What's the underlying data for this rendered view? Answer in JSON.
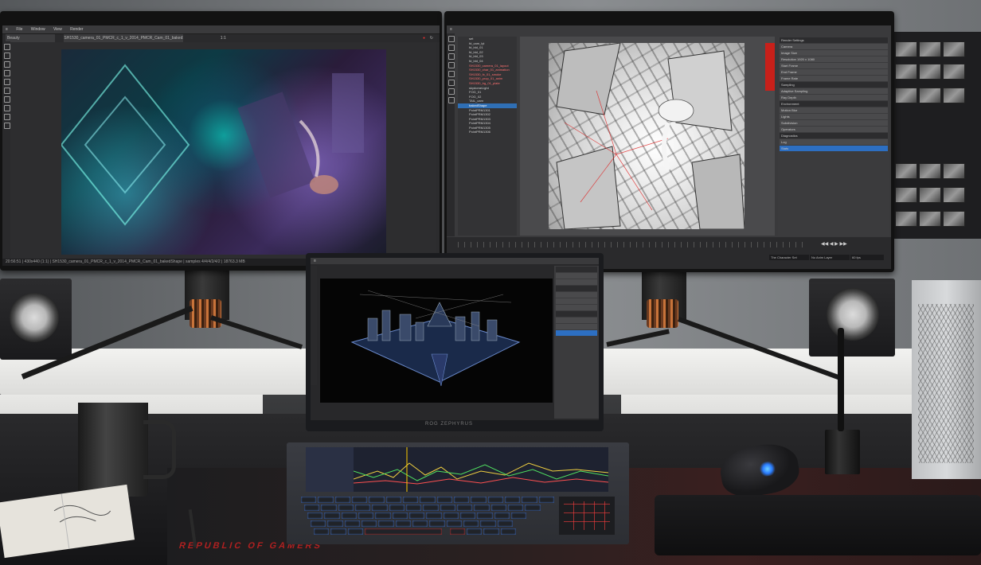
{
  "left_monitor": {
    "menu": [
      "File",
      "Window",
      "View",
      "Render"
    ],
    "layer_select": "Beauty",
    "filename": "SH1530_camera_01_PMCR_c_1_v_2014_PMCR_Cam_01_bakedShape",
    "ratio": "1:1",
    "status_line": "20:56:51 | 430x440 (1:1) | SH1530_camera_01_PMCR_c_1_v_2014_PMCR_Cam_01_bakedShape | samples 4/4/4/2/4/2 | 18763.3 MB"
  },
  "right_monitor": {
    "outliner_rows": [
      {
        "text": "set",
        "style": "normal"
      },
      {
        "text": "fd_cam_lyt",
        "style": "normal"
      },
      {
        "text": "fd_bld_01",
        "style": "normal"
      },
      {
        "text": "fd_bld_02",
        "style": "normal"
      },
      {
        "text": "fd_bld_03",
        "style": "normal"
      },
      {
        "text": "fd_bld_04",
        "style": "normal"
      },
      {
        "text": "SH1530_camera_01_layout",
        "style": "red"
      },
      {
        "text": "SH1530_char_01_animation",
        "style": "red"
      },
      {
        "text": "SH1530_fx_01_smoke",
        "style": "red"
      },
      {
        "text": "SH1530_prop_01_anim",
        "style": "red"
      },
      {
        "text": "SH1530_bg_01_plate",
        "style": "red"
      },
      {
        "text": "skydomeLight",
        "style": "normal"
      },
      {
        "text": "FOG_01",
        "style": "normal"
      },
      {
        "text": "FOG_02",
        "style": "normal"
      },
      {
        "text": "TAIL_cam",
        "style": "normal"
      },
      {
        "text": "bakedShape",
        "style": "sel"
      },
      {
        "text": "PointPRM1301",
        "style": "normal"
      },
      {
        "text": "PointPRM1302",
        "style": "normal"
      },
      {
        "text": "PointPRM1303",
        "style": "normal"
      },
      {
        "text": "PointPRM1304",
        "style": "normal"
      },
      {
        "text": "PointPRM1305",
        "style": "normal"
      },
      {
        "text": "PointPRM1306",
        "style": "normal"
      }
    ],
    "attribute_rows": [
      {
        "text": "Render Settings",
        "style": "hdr"
      },
      {
        "text": "Camera",
        "style": "normal"
      },
      {
        "text": "Image Size",
        "style": "normal"
      },
      {
        "text": "Resolution 1920 x 1080",
        "style": "normal"
      },
      {
        "text": "Start Frame",
        "style": "normal"
      },
      {
        "text": "End Frame",
        "style": "normal"
      },
      {
        "text": "Frame Rate",
        "style": "normal"
      },
      {
        "text": "Sampling",
        "style": "hdr"
      },
      {
        "text": "Adaptive Sampling",
        "style": "normal"
      },
      {
        "text": "Ray Depth",
        "style": "normal"
      },
      {
        "text": "Environment",
        "style": "hdr"
      },
      {
        "text": "Motion Blur",
        "style": "normal"
      },
      {
        "text": "Lights",
        "style": "normal"
      },
      {
        "text": "Subdivision",
        "style": "normal"
      },
      {
        "text": "Operators",
        "style": "normal"
      },
      {
        "text": "Diagnostics",
        "style": "hdr"
      },
      {
        "text": "Log",
        "style": "normal"
      },
      {
        "text": "Stats",
        "style": "blue"
      }
    ],
    "timeline_fields": [
      "The Character Set",
      "No Anim Layer",
      "60 fps"
    ]
  },
  "laptop": {
    "brand": "ROG ZEPHYRUS"
  },
  "desk": {
    "mat_text": "REPUBLIC OF GAMERS"
  }
}
